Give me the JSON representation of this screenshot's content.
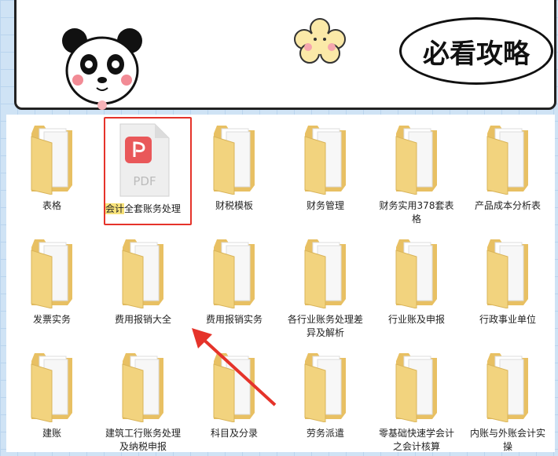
{
  "banner": {
    "title": "必看攻略"
  },
  "files": [
    {
      "name": "表格",
      "type": "folder"
    },
    {
      "name_highlight": "会计",
      "name": "全套账务处理",
      "type": "pdf",
      "icon_text": "PDF",
      "selected": true
    },
    {
      "name": "财税模板",
      "type": "folder"
    },
    {
      "name": "财务管理",
      "type": "folder"
    },
    {
      "name": "财务实用378套表格",
      "type": "folder"
    },
    {
      "name": "产品成本分析表",
      "type": "folder"
    },
    {
      "name": "发票实务",
      "type": "folder"
    },
    {
      "name": "费用报销大全",
      "type": "folder"
    },
    {
      "name": "费用报销实务",
      "type": "folder"
    },
    {
      "name": "各行业账务处理差异及解析",
      "type": "folder"
    },
    {
      "name": "行业账及申报",
      "type": "folder"
    },
    {
      "name": "行政事业单位",
      "type": "folder"
    },
    {
      "name": "建账",
      "type": "folder"
    },
    {
      "name": "建筑工行账务处理及纳税申报",
      "type": "folder"
    },
    {
      "name": "科目及分录",
      "type": "folder"
    },
    {
      "name": "劳务派遣",
      "type": "folder"
    },
    {
      "name": "零基础快速学会计之会计核算",
      "type": "folder"
    },
    {
      "name": "内账与外账会计实操",
      "type": "folder"
    }
  ],
  "colors": {
    "accent": "#e5332a",
    "folder": "#f2d37e",
    "pdf": "#e9585a"
  }
}
